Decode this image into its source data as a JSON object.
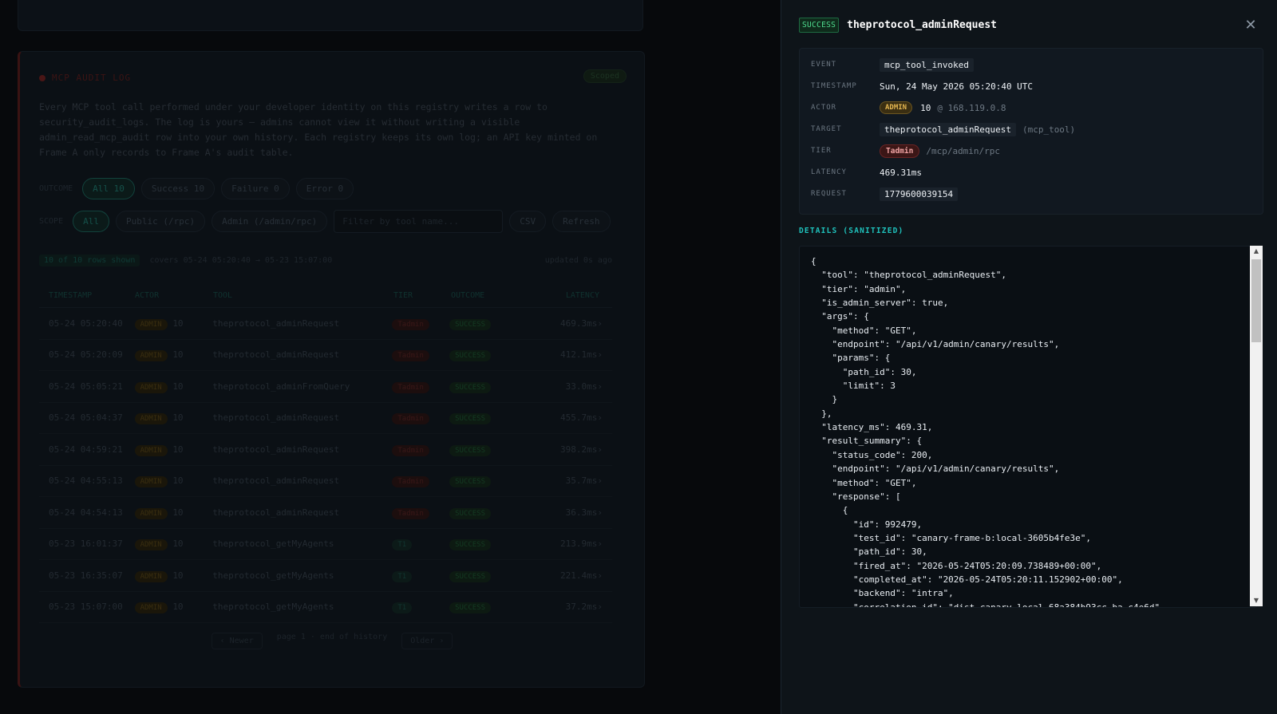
{
  "background": {
    "card_title": "MCP AUDIT LOG",
    "scoped_badge": "Scoped",
    "description": "Every MCP tool call performed under your developer identity on this registry writes a row to security_audit_logs. The log is yours — admins cannot view it without writing a visible admin_read_mcp_audit row into your own history. Each registry keeps its own log; an API key minted on Frame A only records to Frame A's audit table.",
    "outcome_label": "OUTCOME",
    "outcome_filters": [
      {
        "label": "All",
        "count": "10",
        "active": true
      },
      {
        "label": "Success",
        "count": "10",
        "active": false
      },
      {
        "label": "Failure",
        "count": "0",
        "active": false
      },
      {
        "label": "Error",
        "count": "0",
        "active": false
      }
    ],
    "scope_label": "SCOPE",
    "scope_filters": [
      {
        "label": "All",
        "active": true
      },
      {
        "label": "Public (/rpc)",
        "active": false
      },
      {
        "label": "Admin (/admin/rpc)",
        "active": false
      }
    ],
    "tool_filter_placeholder": "Filter by tool name...",
    "csv_button": "CSV",
    "refresh_button": "Refresh",
    "rows_shown": "10 of 10 rows shown",
    "range_text": "covers 05-24 05:20:40 → 05-23 15:07:00",
    "updated_text": "updated 0s ago",
    "columns": [
      "TIMESTAMP",
      "ACTOR",
      "TOOL",
      "TIER",
      "OUTCOME",
      "LATENCY"
    ],
    "rows": [
      {
        "ts": "05-24 05:20:40",
        "actor": "ADMIN",
        "id": "10",
        "tool": "theprotocol_adminRequest",
        "tier": "Tadmin",
        "outcome": "SUCCESS",
        "latency": "469.3ms"
      },
      {
        "ts": "05-24 05:20:09",
        "actor": "ADMIN",
        "id": "10",
        "tool": "theprotocol_adminRequest",
        "tier": "Tadmin",
        "outcome": "SUCCESS",
        "latency": "412.1ms"
      },
      {
        "ts": "05-24 05:05:21",
        "actor": "ADMIN",
        "id": "10",
        "tool": "theprotocol_adminFromQuery",
        "tier": "Tadmin",
        "outcome": "SUCCESS",
        "latency": "33.0ms"
      },
      {
        "ts": "05-24 05:04:37",
        "actor": "ADMIN",
        "id": "10",
        "tool": "theprotocol_adminRequest",
        "tier": "Tadmin",
        "outcome": "SUCCESS",
        "latency": "455.7ms"
      },
      {
        "ts": "05-24 04:59:21",
        "actor": "ADMIN",
        "id": "10",
        "tool": "theprotocol_adminRequest",
        "tier": "Tadmin",
        "outcome": "SUCCESS",
        "latency": "398.2ms"
      },
      {
        "ts": "05-24 04:55:13",
        "actor": "ADMIN",
        "id": "10",
        "tool": "theprotocol_adminRequest",
        "tier": "Tadmin",
        "outcome": "SUCCESS",
        "latency": "35.7ms"
      },
      {
        "ts": "05-24 04:54:13",
        "actor": "ADMIN",
        "id": "10",
        "tool": "theprotocol_adminRequest",
        "tier": "Tadmin",
        "outcome": "SUCCESS",
        "latency": "36.3ms"
      },
      {
        "ts": "05-23 16:01:37",
        "actor": "ADMIN",
        "id": "10",
        "tool": "theprotocol_getMyAgents",
        "tier": "T1",
        "outcome": "SUCCESS",
        "latency": "213.9ms"
      },
      {
        "ts": "05-23 16:35:07",
        "actor": "ADMIN",
        "id": "10",
        "tool": "theprotocol_getMyAgents",
        "tier": "T1",
        "outcome": "SUCCESS",
        "latency": "221.4ms"
      },
      {
        "ts": "05-23 15:07:00",
        "actor": "ADMIN",
        "id": "10",
        "tool": "theprotocol_getMyAgents",
        "tier": "T1",
        "outcome": "SUCCESS",
        "latency": "37.2ms"
      }
    ],
    "pager_prev": "‹ Newer",
    "pager_text": "page 1 · end of history",
    "pager_next": "Older ›"
  },
  "drawer": {
    "status": "SUCCESS",
    "title": "theprotocol_adminRequest",
    "close_glyph": "✕",
    "meta": {
      "event_label": "EVENT",
      "event": "mcp_tool_invoked",
      "timestamp_label": "TIMESTAMP",
      "timestamp": "Sun, 24 May 2026 05:20:40 UTC",
      "actor_label": "ACTOR",
      "actor_role": "ADMIN",
      "actor_id": "10",
      "actor_ip": "@ 168.119.0.8",
      "target_label": "TARGET",
      "target": "theprotocol_adminRequest",
      "target_type": "(mcp_tool)",
      "tier_label": "TIER",
      "tier": "Tadmin",
      "tier_path": "/mcp/admin/rpc",
      "latency_label": "LATENCY",
      "latency": "469.31ms",
      "request_label": "REQUEST",
      "request": "1779600039154"
    },
    "details_label": "DETAILS (SANITIZED)",
    "details_json": "{\n  \"tool\": \"theprotocol_adminRequest\",\n  \"tier\": \"admin\",\n  \"is_admin_server\": true,\n  \"args\": {\n    \"method\": \"GET\",\n    \"endpoint\": \"/api/v1/admin/canary/results\",\n    \"params\": {\n      \"path_id\": 30,\n      \"limit\": 3\n    }\n  },\n  \"latency_ms\": 469.31,\n  \"result_summary\": {\n    \"status_code\": 200,\n    \"endpoint\": \"/api/v1/admin/canary/results\",\n    \"method\": \"GET\",\n    \"response\": [\n      {\n        \"id\": 992479,\n        \"test_id\": \"canary-frame-b:local-3605b4fe3e\",\n        \"path_id\": 30,\n        \"fired_at\": \"2026-05-24T05:20:09.738489+00:00\",\n        \"completed_at\": \"2026-05-24T05:20:11.152902+00:00\",\n        \"backend\": \"intra\",\n        \"correlation_id\": \"dist-canary-local-68a384b93cc-ba-c4e6d\","
  }
}
